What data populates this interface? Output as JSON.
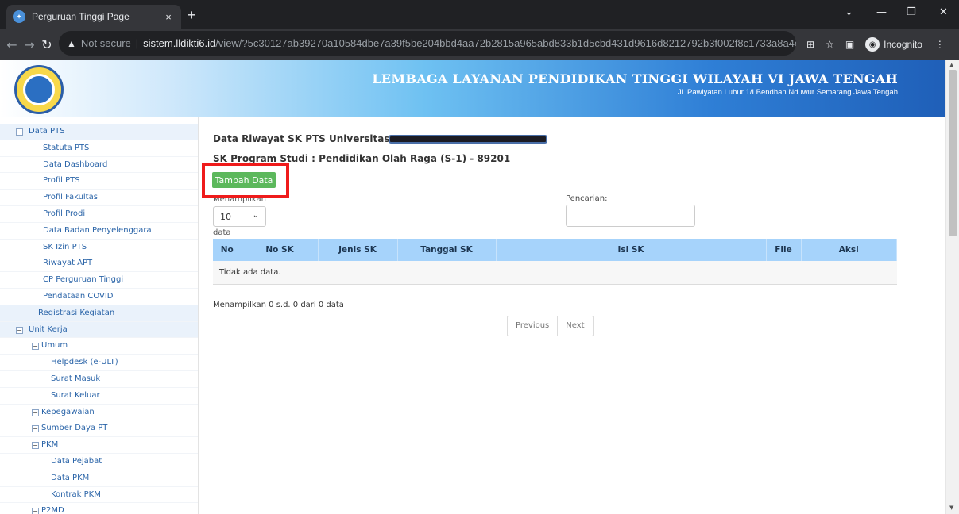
{
  "browser": {
    "tab_title": "Perguruan Tinggi Page",
    "tab_close": "×",
    "new_tab": "+",
    "not_secure": "Not secure",
    "url_host": "sistem.lldikti6.id",
    "url_path": "/view/?5c30127ab39270a10584dbe7a39f5be204bbd4aa72b2815a965abd833b1d5cbd431d9616d8212792b3f002f8c1733a8a4e5...",
    "incognito_label": "Incognito"
  },
  "header": {
    "title": "LEMBAGA LAYANAN PENDIDIKAN TINGGI WILAYAH VI JAWA TENGAH",
    "address": "Jl. Pawiyatan Luhur 1/I Bendhan Nduwur Semarang Jawa Tengah"
  },
  "sidebar": {
    "items": [
      {
        "label": "Data PTS"
      },
      {
        "label": "Statuta PTS"
      },
      {
        "label": "Data Dashboard"
      },
      {
        "label": "Profil PTS"
      },
      {
        "label": "Profil Fakultas"
      },
      {
        "label": "Profil Prodi"
      },
      {
        "label": "Data Badan Penyelenggara"
      },
      {
        "label": "SK Izin PTS"
      },
      {
        "label": "Riwayat APT"
      },
      {
        "label": "CP Perguruan Tinggi"
      },
      {
        "label": "Pendataan COVID"
      },
      {
        "label": "Registrasi Kegiatan"
      },
      {
        "label": "Unit Kerja"
      },
      {
        "label": "Umum"
      },
      {
        "label": "Helpdesk (e-ULT)"
      },
      {
        "label": "Surat Masuk"
      },
      {
        "label": "Surat Keluar"
      },
      {
        "label": "Kepegawaian"
      },
      {
        "label": "Sumber Daya PT"
      },
      {
        "label": "PKM"
      },
      {
        "label": "Data Pejabat"
      },
      {
        "label": "Data PKM"
      },
      {
        "label": "Kontrak PKM"
      },
      {
        "label": "P2MD"
      }
    ]
  },
  "main": {
    "heading1": "Data Riwayat SK PTS Universitas",
    "heading2": "SK Program Studi : Pendidikan Olah Raga (S-1) - 89201",
    "add_button": "Tambah Data",
    "show_label": "Menampilkan",
    "length_value": "10",
    "data_label": "data",
    "search_label": "Pencarian:",
    "table": {
      "columns": [
        "No",
        "No SK",
        "Jenis SK",
        "Tanggal SK",
        "Isi SK",
        "File",
        "Aksi"
      ],
      "empty": "Tidak ada data."
    },
    "info": "Menampilkan 0 s.d. 0 dari 0 data",
    "pager": {
      "previous": "Previous",
      "next": "Next"
    }
  },
  "colors": {
    "add_button": "#5cb85c",
    "highlight_box": "#ef1b1b",
    "table_header": "#a6d3fb",
    "sidebar_link": "#2a64a8"
  }
}
